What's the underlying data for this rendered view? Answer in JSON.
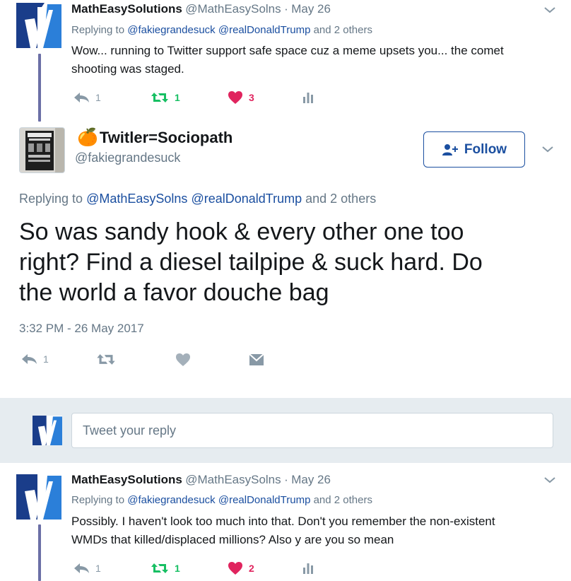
{
  "tweet1": {
    "name": "MathEasySolutions",
    "handle": "@MathEasySolns",
    "separator": "·",
    "date": "May 26",
    "replying_prefix": "Replying to",
    "mentions": [
      "@fakiegrandesuck",
      "@realDonaldTrump"
    ],
    "replying_suffix": "and 2 others",
    "text_line1": "Wow... running to Twitter support safe space cuz a meme upsets you... the comet",
    "text_line2": "shooting was staged.",
    "reply_count": "1",
    "retweet_count": "1",
    "like_count": "3"
  },
  "main_tweet": {
    "emoji": "🍊",
    "name": "Twitler=Sociopath",
    "handle": "@fakiegrandesuck",
    "follow_label": "Follow",
    "replying_prefix": "Replying to",
    "mentions": [
      "@MathEasySolns",
      "@realDonaldTrump"
    ],
    "replying_suffix": "and 2 others",
    "text_line1": "So was sandy hook & every other one too",
    "text_line2": "right? Find a diesel tailpipe & suck hard. Do",
    "text_line3": "the world a favor douche bag",
    "timestamp": "3:32 PM - 26 May 2017",
    "reply_count": "1"
  },
  "reply_box": {
    "placeholder": "Tweet your reply"
  },
  "tweet3": {
    "name": "MathEasySolutions",
    "handle": "@MathEasySolns",
    "separator": "·",
    "date": "May 26",
    "replying_prefix": "Replying to",
    "mentions": [
      "@fakiegrandesuck",
      "@realDonaldTrump"
    ],
    "replying_suffix": "and 2 others",
    "text_line1": "Possibly. I haven't look too much into that. Don't you remember the non-existent",
    "text_line2": "WMDs that killed/displaced millions? Also y are you so mean",
    "reply_count": "1",
    "retweet_count": "1",
    "like_count": "2"
  },
  "colors": {
    "retweet": "#17bf63",
    "like": "#e0245e",
    "link": "#1b4fa0",
    "muted": "#657786",
    "action_gray": "#8899a6"
  }
}
